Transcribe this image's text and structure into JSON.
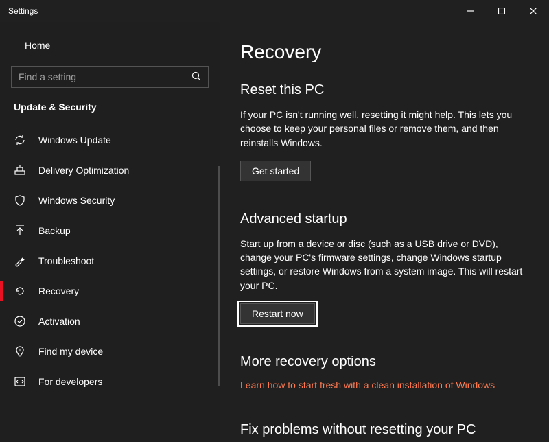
{
  "window": {
    "title": "Settings"
  },
  "sidebar": {
    "home_label": "Home",
    "search_placeholder": "Find a setting",
    "category_title": "Update & Security",
    "items": [
      {
        "label": "Windows Update",
        "icon": "sync-icon"
      },
      {
        "label": "Delivery Optimization",
        "icon": "delivery-icon"
      },
      {
        "label": "Windows Security",
        "icon": "shield-icon"
      },
      {
        "label": "Backup",
        "icon": "backup-icon"
      },
      {
        "label": "Troubleshoot",
        "icon": "wrench-icon"
      },
      {
        "label": "Recovery",
        "icon": "recovery-icon"
      },
      {
        "label": "Activation",
        "icon": "activation-icon"
      },
      {
        "label": "Find my device",
        "icon": "location-icon"
      },
      {
        "label": "For developers",
        "icon": "developer-icon"
      }
    ]
  },
  "main": {
    "title": "Recovery",
    "reset": {
      "heading": "Reset this PC",
      "body": "If your PC isn't running well, resetting it might help. This lets you choose to keep your personal files or remove them, and then reinstalls Windows.",
      "button": "Get started"
    },
    "advanced": {
      "heading": "Advanced startup",
      "body": "Start up from a device or disc (such as a USB drive or DVD), change your PC's firmware settings, change Windows startup settings, or restore Windows from a system image. This will restart your PC.",
      "button": "Restart now"
    },
    "more": {
      "heading": "More recovery options",
      "link": "Learn how to start fresh with a clean installation of Windows"
    },
    "fix": {
      "heading": "Fix problems without resetting your PC"
    }
  }
}
